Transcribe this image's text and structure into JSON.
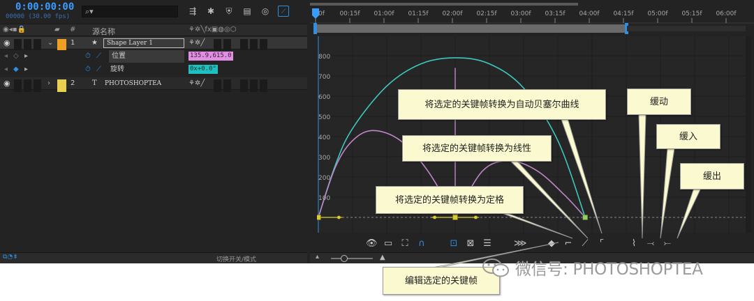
{
  "timeline": {
    "timecode": "0:00:00:00",
    "fps": "00000 (30.00 fps)"
  },
  "columns": {
    "hash": "#",
    "source_name": "源名称"
  },
  "layers": [
    {
      "index": "1",
      "name": "Shape Layer 1",
      "color": "#f0a020"
    },
    {
      "index": "2",
      "name": "PHOTOSHOPTEA",
      "color": "#e8d050"
    }
  ],
  "properties": [
    {
      "name": "位置",
      "value": "135.9,615.0",
      "value_color": "#e090e0"
    },
    {
      "name": "旋转",
      "value": "0x+0.0°",
      "value_color": "#20c0c0"
    }
  ],
  "footer_left": {
    "toggle_label": "切换开关/模式"
  },
  "ruler": {
    "labels": [
      "0f",
      "00:15f",
      "01:00f",
      "01:15f",
      "02:00f",
      "02:15f",
      "03:00f",
      "03:15f",
      "04:00f",
      "04:15f",
      "05:00f",
      "05:15f",
      "06:00f"
    ]
  },
  "graph": {
    "y_labels": [
      "800",
      "700",
      "600",
      "500",
      "400",
      "300",
      "200",
      "100"
    ]
  },
  "chart_data": {
    "type": "line",
    "title": "",
    "xlabel": "",
    "ylabel": "",
    "x_unit": "seconds",
    "xlim": [
      0,
      6.0
    ],
    "ylim": [
      -20,
      860
    ],
    "series": [
      {
        "color": "#3cc8c0",
        "x": [
          0,
          0.25,
          0.5,
          1.0,
          1.5,
          2.0,
          2.5,
          3.0,
          3.5,
          3.9
        ],
        "y": [
          0,
          260,
          440,
          650,
          760,
          790,
          760,
          640,
          380,
          0
        ]
      },
      {
        "color": "#c086c8",
        "x": [
          0,
          0.25,
          0.5,
          0.8,
          1.2,
          1.6,
          2.0
        ],
        "y": [
          0,
          250,
          380,
          430,
          380,
          230,
          0
        ]
      },
      {
        "color": "#c086c8",
        "x": [
          2.0,
          2.4,
          2.8,
          3.2,
          3.6,
          3.9
        ],
        "y": [
          0,
          230,
          280,
          230,
          110,
          0
        ]
      }
    ],
    "keyframes": [
      {
        "x": 0,
        "y": 0
      },
      {
        "x": 2.0,
        "y": 0
      },
      {
        "x": 3.9,
        "y": 0
      }
    ],
    "handles": [
      {
        "x": 0.3,
        "y": 0
      },
      {
        "x": 1.7,
        "y": 0
      },
      {
        "x": 2.3,
        "y": 0
      }
    ]
  },
  "callouts": {
    "auto_bezier": "将选定的关键帧转换为自动贝塞尔曲线",
    "linear": "将选定的关键帧转换为线性",
    "hold": "将选定的关键帧转换为定格",
    "edit": "编辑选定的关键帧",
    "easy_ease": "缓动",
    "ease_in": "缓入",
    "ease_out": "缓出"
  },
  "watermark": {
    "text": "微信号: PHOTOSHOPTEA"
  },
  "colors": {
    "timecode": "#3b9cff",
    "accent_blue": "#2e8fe0",
    "callout_bg": "#fbf9cf",
    "curve_cyan": "#3cc8c0",
    "curve_pink": "#c086c8",
    "keyframe_yellow": "#d8cc30"
  },
  "icons": {
    "search": "search-icon",
    "eye": "eye-icon",
    "stopwatch": "stopwatch-icon",
    "graph": "graph-icon",
    "star": "star-icon",
    "text_layer": "text-layer-icon"
  }
}
